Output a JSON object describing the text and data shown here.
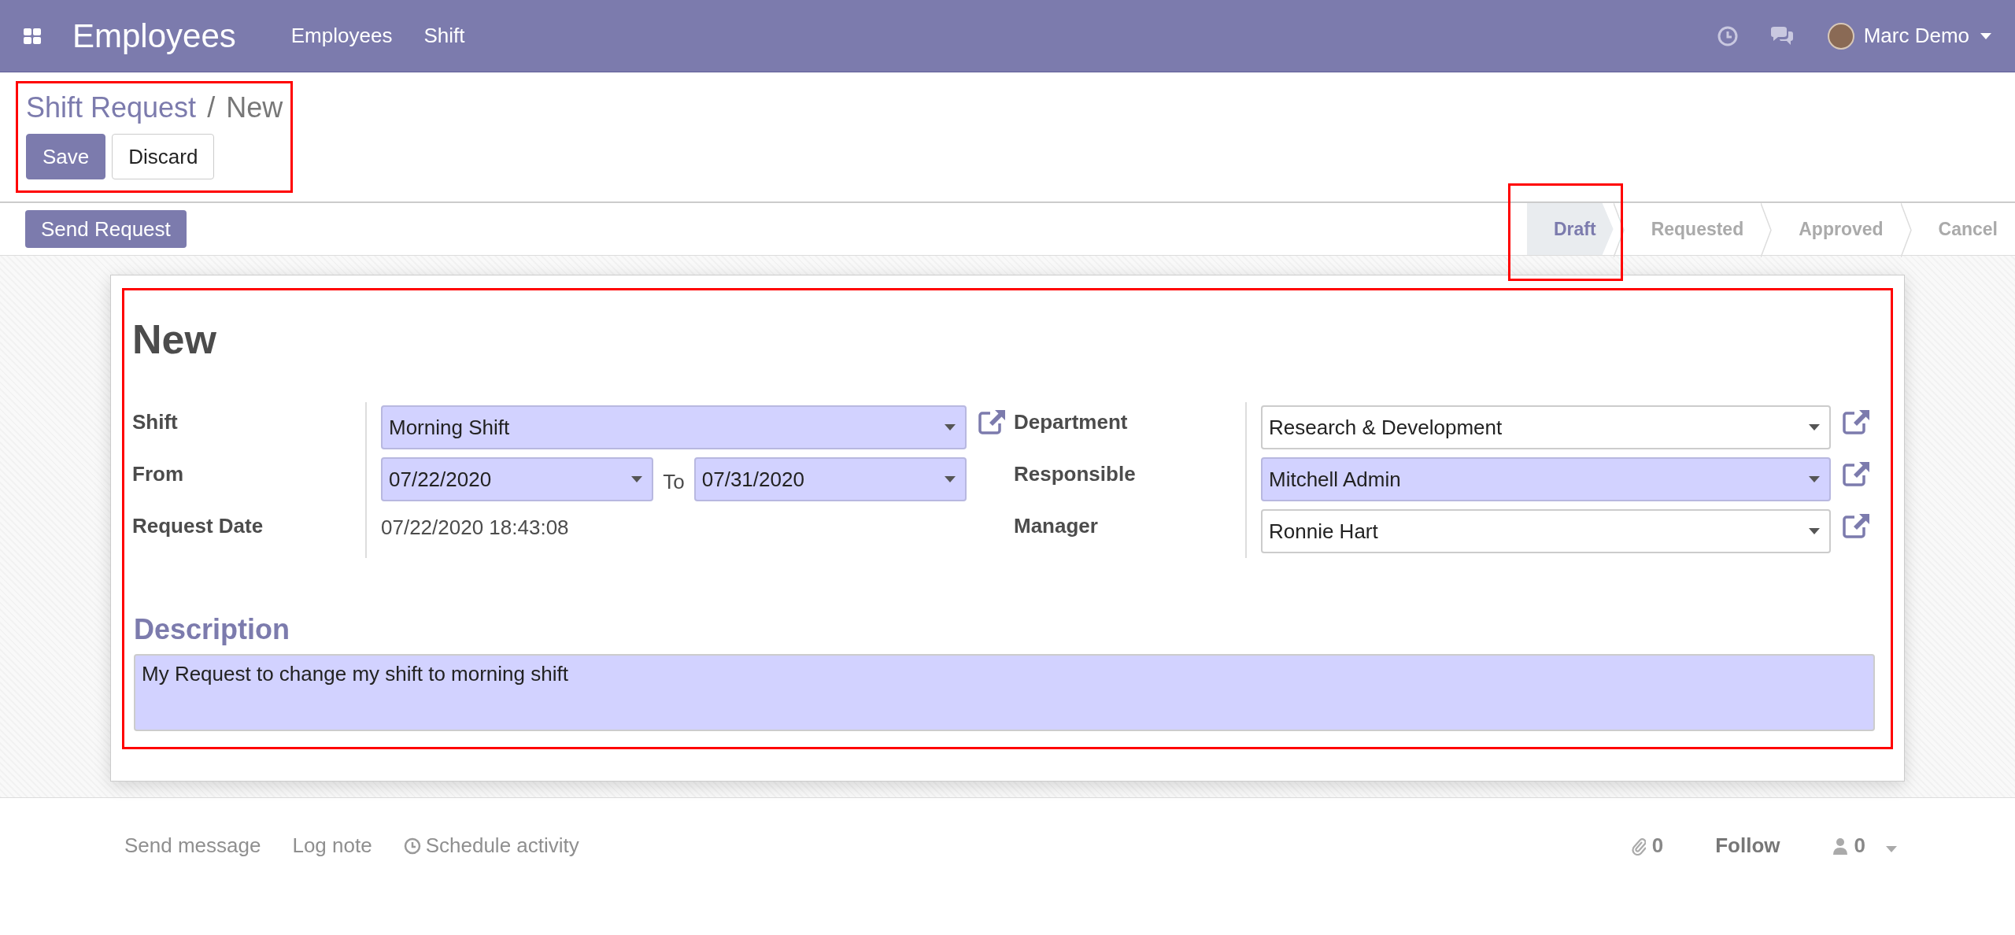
{
  "app": {
    "name": "Employees",
    "menu": [
      "Employees",
      "Shift"
    ],
    "user": "Marc Demo"
  },
  "breadcrumb": {
    "parent": "Shift Request",
    "separator": "/",
    "current": "New"
  },
  "buttons": [
    {
      "label": "Save",
      "kind": "primary"
    },
    {
      "label": "Discard",
      "kind": "secondary"
    }
  ],
  "status_bar": {
    "action": "Send Request",
    "stages": [
      {
        "label": "Draft",
        "selected": true
      },
      {
        "label": "Requested",
        "selected": false
      },
      {
        "label": "Approved",
        "selected": false
      },
      {
        "label": "Cancel",
        "selected": false
      }
    ]
  },
  "form": {
    "title": "New",
    "left": [
      {
        "label": "Shift",
        "kind": "select",
        "value": "Morning Shift",
        "required": true,
        "link": true
      },
      {
        "label": "From",
        "kind": "range",
        "value": "07/22/2020",
        "separator": "To",
        "value_end": "07/31/2020",
        "required": true
      },
      {
        "label": "Request Date",
        "kind": "text",
        "value": "07/22/2020 18:43:08"
      }
    ],
    "right": [
      {
        "label": "Department",
        "kind": "select",
        "value": "Research & Development",
        "required": false,
        "link": true
      },
      {
        "label": "Responsible",
        "kind": "select",
        "value": "Mitchell Admin",
        "required": true,
        "link": true
      },
      {
        "label": "Manager",
        "kind": "select",
        "value": "Ronnie Hart",
        "required": false,
        "link": true
      }
    ],
    "description": {
      "heading": "Description",
      "value": "My Request to change my shift to morning shift",
      "required": true
    }
  },
  "chatter": {
    "actions": [
      {
        "label": "Send message",
        "icon": false
      },
      {
        "label": "Log note",
        "icon": false
      },
      {
        "label": "Schedule activity",
        "icon": true
      }
    ],
    "attachments": "0",
    "follow": "Follow",
    "followers": "0"
  }
}
